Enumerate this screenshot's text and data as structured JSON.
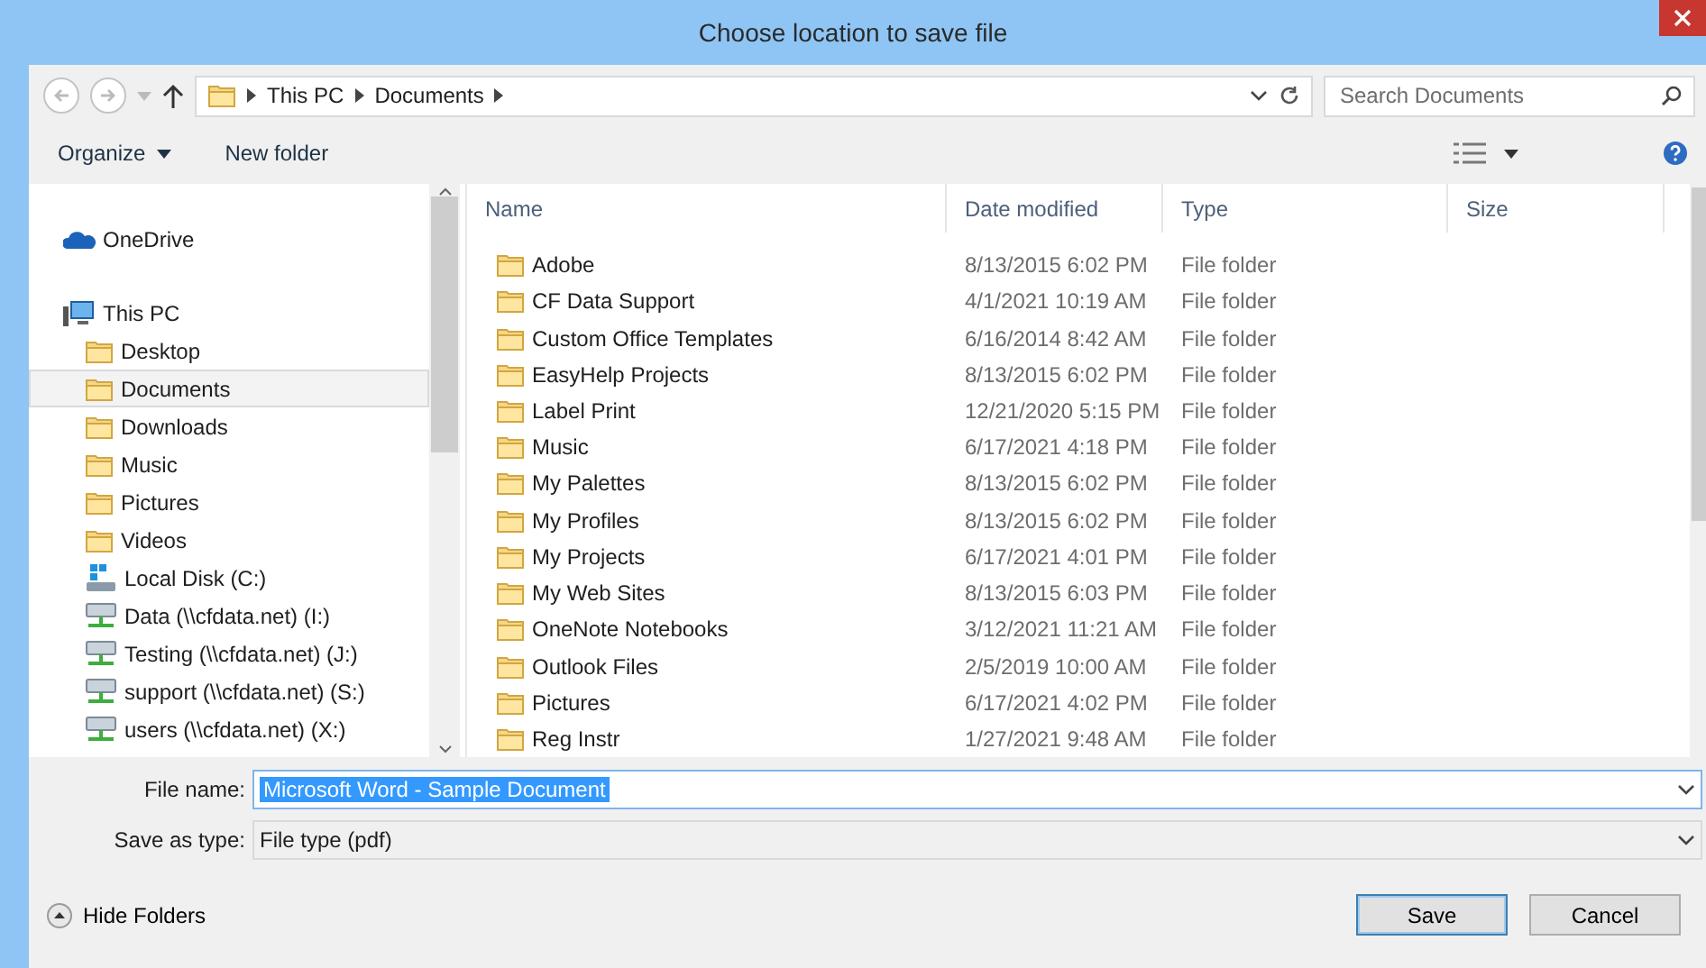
{
  "window": {
    "title": "Choose location to save file"
  },
  "address_bar": {
    "crumbs": [
      "This PC",
      "Documents"
    ]
  },
  "search": {
    "placeholder": "Search Documents"
  },
  "toolbar": {
    "organize": "Organize",
    "new_folder": "New folder"
  },
  "sidebar": {
    "items": [
      {
        "label": "OneDrive",
        "kind": "cloud",
        "selected": false
      },
      {
        "label": "This PC",
        "kind": "pc",
        "selected": false,
        "children": [
          {
            "label": "Desktop",
            "kind": "folder",
            "selected": false
          },
          {
            "label": "Documents",
            "kind": "folder",
            "selected": true
          },
          {
            "label": "Downloads",
            "kind": "folder",
            "selected": false
          },
          {
            "label": "Music",
            "kind": "folder",
            "selected": false
          },
          {
            "label": "Pictures",
            "kind": "folder",
            "selected": false
          },
          {
            "label": "Videos",
            "kind": "folder",
            "selected": false
          },
          {
            "label": "Local Disk (C:)",
            "kind": "disk",
            "selected": false
          },
          {
            "label": "Data (\\\\cfdata.net) (I:)",
            "kind": "network",
            "selected": false
          },
          {
            "label": "Testing (\\\\cfdata.net) (J:)",
            "kind": "network",
            "selected": false
          },
          {
            "label": "support (\\\\cfdata.net) (S:)",
            "kind": "network",
            "selected": false
          },
          {
            "label": "users (\\\\cfdata.net) (X:)",
            "kind": "network",
            "selected": false
          }
        ]
      }
    ]
  },
  "table": {
    "columns": [
      "Name",
      "Date modified",
      "Type",
      "Size"
    ],
    "rows": [
      {
        "name": "Adobe",
        "date": "8/13/2015 6:02 PM",
        "type": "File folder"
      },
      {
        "name": "CF Data Support",
        "date": "4/1/2021 10:19 AM",
        "type": "File folder"
      },
      {
        "name": "Custom Office Templates",
        "date": "6/16/2014 8:42 AM",
        "type": "File folder"
      },
      {
        "name": "EasyHelp Projects",
        "date": "8/13/2015 6:02 PM",
        "type": "File folder"
      },
      {
        "name": "Label Print",
        "date": "12/21/2020 5:15 PM",
        "type": "File folder"
      },
      {
        "name": "Music",
        "date": "6/17/2021 4:18 PM",
        "type": "File folder"
      },
      {
        "name": "My Palettes",
        "date": "8/13/2015 6:02 PM",
        "type": "File folder"
      },
      {
        "name": "My Profiles",
        "date": "8/13/2015 6:02 PM",
        "type": "File folder"
      },
      {
        "name": "My Projects",
        "date": "6/17/2021 4:01 PM",
        "type": "File folder"
      },
      {
        "name": "My Web Sites",
        "date": "8/13/2015 6:03 PM",
        "type": "File folder"
      },
      {
        "name": "OneNote Notebooks",
        "date": "3/12/2021 11:21 AM",
        "type": "File folder"
      },
      {
        "name": "Outlook Files",
        "date": "2/5/2019 10:00 AM",
        "type": "File folder"
      },
      {
        "name": "Pictures",
        "date": "6/17/2021 4:02 PM",
        "type": "File folder"
      },
      {
        "name": "Reg Instr",
        "date": "1/27/2021 9:48 AM",
        "type": "File folder"
      }
    ]
  },
  "file_name": {
    "label": "File name:",
    "value": "Microsoft Word - Sample Document"
  },
  "save_as_type": {
    "label": "Save as type:",
    "value": "File type (pdf)"
  },
  "hide_folders": "Hide Folders",
  "buttons": [
    "Save",
    "Cancel"
  ]
}
